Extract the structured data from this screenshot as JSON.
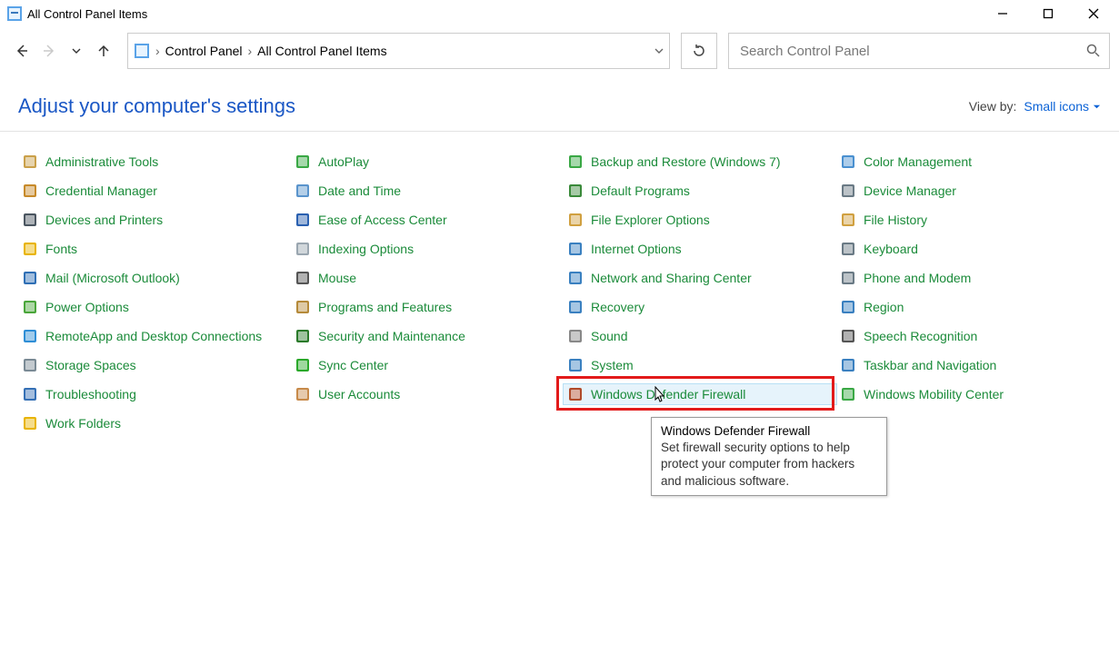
{
  "window": {
    "title": "All Control Panel Items"
  },
  "breadcrumbs": {
    "root": "Control Panel",
    "current": "All Control Panel Items"
  },
  "search": {
    "placeholder": "Search Control Panel"
  },
  "heading": "Adjust your computer's settings",
  "view_by": {
    "label": "View by:",
    "value": "Small icons"
  },
  "columns": [
    {
      "items": [
        {
          "id": "administrative-tools",
          "label": "Administrative Tools"
        },
        {
          "id": "credential-manager",
          "label": "Credential Manager"
        },
        {
          "id": "devices-and-printers",
          "label": "Devices and Printers"
        },
        {
          "id": "fonts",
          "label": "Fonts"
        },
        {
          "id": "mail-outlook",
          "label": "Mail (Microsoft Outlook)"
        },
        {
          "id": "power-options",
          "label": "Power Options"
        },
        {
          "id": "remoteapp-desktop-connections",
          "label": "RemoteApp and Desktop Connections"
        },
        {
          "id": "storage-spaces",
          "label": "Storage Spaces"
        },
        {
          "id": "troubleshooting",
          "label": "Troubleshooting"
        },
        {
          "id": "work-folders",
          "label": "Work Folders"
        }
      ]
    },
    {
      "items": [
        {
          "id": "autoplay",
          "label": "AutoPlay"
        },
        {
          "id": "date-and-time",
          "label": "Date and Time"
        },
        {
          "id": "ease-of-access-center",
          "label": "Ease of Access Center"
        },
        {
          "id": "indexing-options",
          "label": "Indexing Options"
        },
        {
          "id": "mouse",
          "label": "Mouse"
        },
        {
          "id": "programs-and-features",
          "label": "Programs and Features"
        },
        {
          "id": "security-and-maintenance",
          "label": "Security and Maintenance"
        },
        {
          "id": "sync-center",
          "label": "Sync Center"
        },
        {
          "id": "user-accounts",
          "label": "User Accounts"
        }
      ]
    },
    {
      "items": [
        {
          "id": "backup-and-restore",
          "label": "Backup and Restore (Windows 7)"
        },
        {
          "id": "default-programs",
          "label": "Default Programs"
        },
        {
          "id": "file-explorer-options",
          "label": "File Explorer Options"
        },
        {
          "id": "internet-options",
          "label": "Internet Options"
        },
        {
          "id": "network-and-sharing-center",
          "label": "Network and Sharing Center"
        },
        {
          "id": "recovery",
          "label": "Recovery"
        },
        {
          "id": "sound",
          "label": "Sound"
        },
        {
          "id": "system",
          "label": "System"
        },
        {
          "id": "windows-defender-firewall",
          "label": "Windows Defender Firewall",
          "hovered": true,
          "highlighted": true
        }
      ]
    },
    {
      "items": [
        {
          "id": "color-management",
          "label": "Color Management"
        },
        {
          "id": "device-manager",
          "label": "Device Manager"
        },
        {
          "id": "file-history",
          "label": "File History"
        },
        {
          "id": "keyboard",
          "label": "Keyboard"
        },
        {
          "id": "phone-and-modem",
          "label": "Phone and Modem"
        },
        {
          "id": "region",
          "label": "Region"
        },
        {
          "id": "speech-recognition",
          "label": "Speech Recognition"
        },
        {
          "id": "taskbar-and-navigation",
          "label": "Taskbar and Navigation"
        },
        {
          "id": "windows-mobility-center",
          "label": "Windows Mobility Center"
        }
      ]
    }
  ],
  "tooltip": {
    "title": "Windows Defender Firewall",
    "body": "Set firewall security options to help protect your computer from hackers and malicious software."
  }
}
